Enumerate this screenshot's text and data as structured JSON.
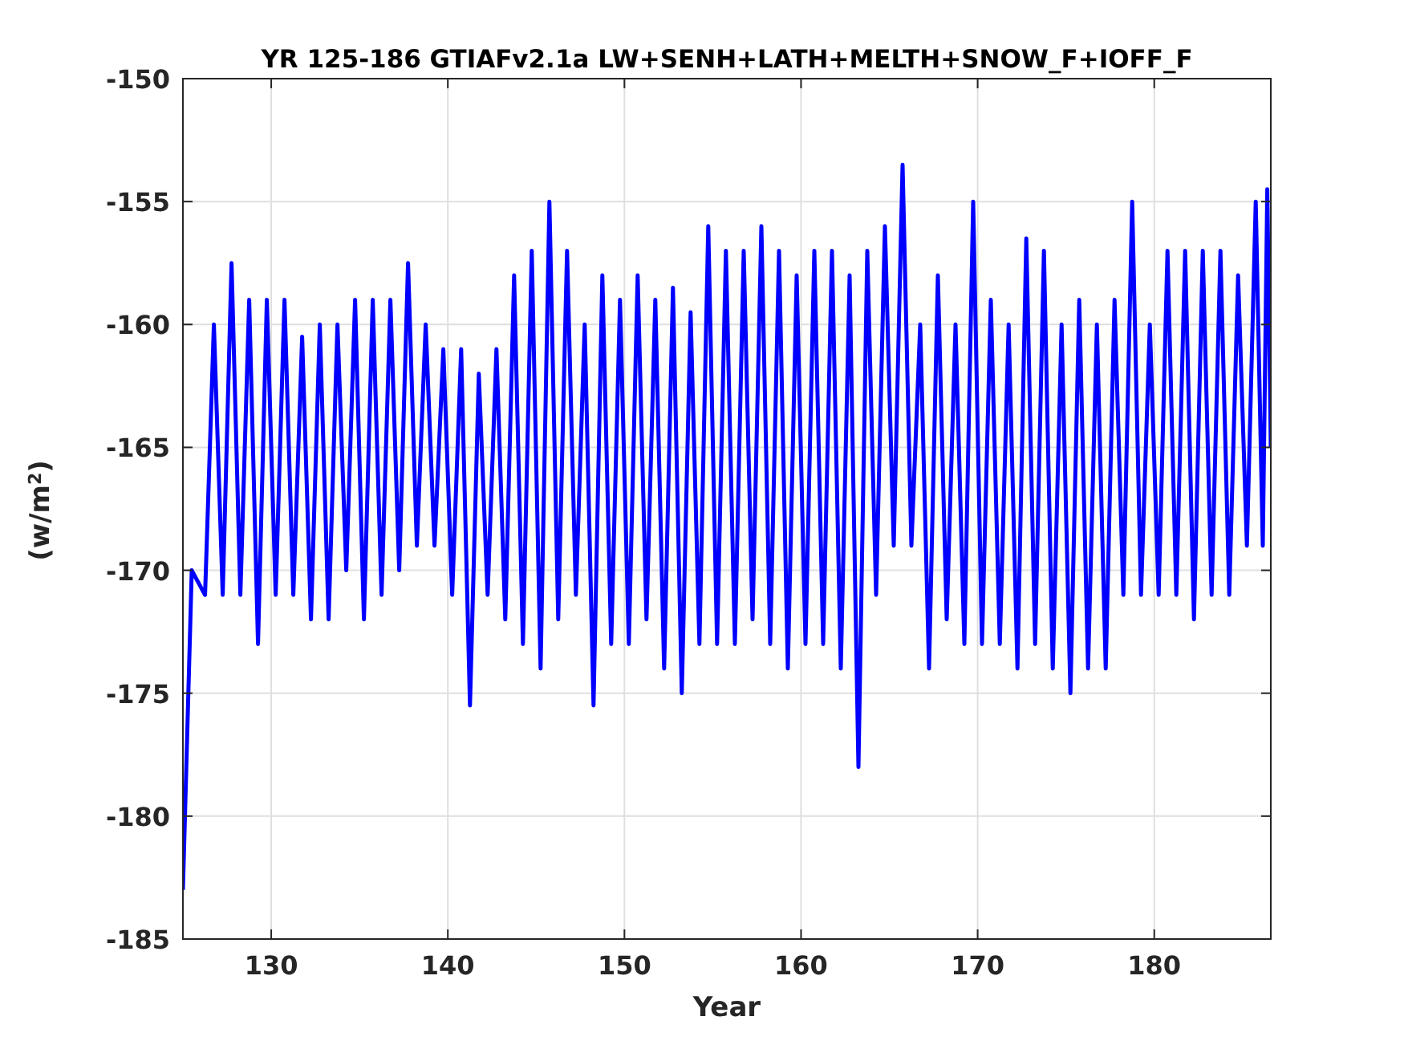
{
  "figure": {
    "chart_data": {
      "type": "line",
      "title": "YR 125-186 GTIAFv2.1a LW+SENH+LATH+MELTH+SNOW_F+IOFF_F",
      "xlabel": "Year",
      "ylabel": "(w/m$^{2}$)",
      "xlim": [
        125,
        186.6
      ],
      "ylim": [
        -185,
        -150
      ],
      "xticks": [
        130,
        140,
        150,
        160,
        170,
        180
      ],
      "yticks": [
        -185,
        -180,
        -175,
        -170,
        -165,
        -160,
        -155,
        -150
      ],
      "grid": true,
      "x": [
        125,
        125.5,
        126.25,
        126.75,
        127.25,
        127.75,
        128.25,
        128.75,
        129.25,
        129.75,
        130.25,
        130.75,
        131.25,
        131.75,
        132.25,
        132.75,
        133.25,
        133.75,
        134.25,
        134.75,
        135.25,
        135.75,
        136.25,
        136.75,
        137.25,
        137.75,
        138.25,
        138.75,
        139.25,
        139.75,
        140.25,
        140.75,
        141.25,
        141.75,
        142.25,
        142.75,
        143.25,
        143.75,
        144.25,
        144.75,
        145.25,
        145.75,
        146.25,
        146.75,
        147.25,
        147.75,
        148.25,
        148.75,
        149.25,
        149.75,
        150.25,
        150.75,
        151.25,
        151.75,
        152.25,
        152.75,
        153.25,
        153.75,
        154.25,
        154.75,
        155.25,
        155.75,
        156.25,
        156.75,
        157.25,
        157.75,
        158.25,
        158.75,
        159.25,
        159.75,
        160.25,
        160.75,
        161.25,
        161.75,
        162.25,
        162.75,
        163.25,
        163.75,
        164.25,
        164.75,
        165.25,
        165.75,
        166.25,
        166.75,
        167.25,
        167.75,
        168.25,
        168.75,
        169.25,
        169.75,
        170.25,
        170.75,
        171.25,
        171.75,
        172.25,
        172.75,
        173.25,
        173.75,
        174.25,
        174.75,
        175.25,
        175.75,
        176.25,
        176.75,
        177.25,
        177.75,
        178.25,
        178.75,
        179.25,
        179.75,
        180.25,
        180.75,
        181.25,
        181.75,
        182.25,
        182.75,
        183.25,
        183.75,
        184.25,
        184.75,
        185.25,
        185.75,
        186.15,
        186.4,
        186.6
      ],
      "series": [
        {
          "color": "#0000ff",
          "values": [
            -183,
            -170,
            -171,
            -160,
            -171,
            -157.5,
            -171,
            -159,
            -173,
            -159,
            -171,
            -159,
            -171,
            -160.5,
            -172,
            -160,
            -172,
            -160,
            -170,
            -159,
            -172,
            -159,
            -171,
            -159,
            -170,
            -157.5,
            -169,
            -160,
            -169,
            -161,
            -171,
            -161,
            -175.5,
            -162,
            -171,
            -161,
            -172,
            -158,
            -173,
            -157,
            -174,
            -155,
            -172,
            -157,
            -171,
            -160,
            -175.5,
            -158,
            -173,
            -159,
            -173,
            -158,
            -172,
            -159,
            -174,
            -158.5,
            -175,
            -159.5,
            -173,
            -156,
            -173,
            -157,
            -173,
            -157,
            -172,
            -156,
            -173,
            -157,
            -174,
            -158,
            -173,
            -157,
            -173,
            -157,
            -174,
            -158,
            -178,
            -157,
            -171,
            -156,
            -169,
            -153.5,
            -169,
            -160,
            -174,
            -158,
            -172,
            -160,
            -173,
            -155,
            -173,
            -159,
            -173,
            -160,
            -174,
            -156.5,
            -173,
            -157,
            -174,
            -160,
            -175,
            -159,
            -174,
            -160,
            -174,
            -159,
            -171,
            -155,
            -171,
            -160,
            -171,
            -157,
            -171,
            -157,
            -172,
            -157,
            -171,
            -157,
            -171,
            -158,
            -169,
            -155,
            -169,
            -154.5,
            -165
          ]
        }
      ]
    }
  }
}
